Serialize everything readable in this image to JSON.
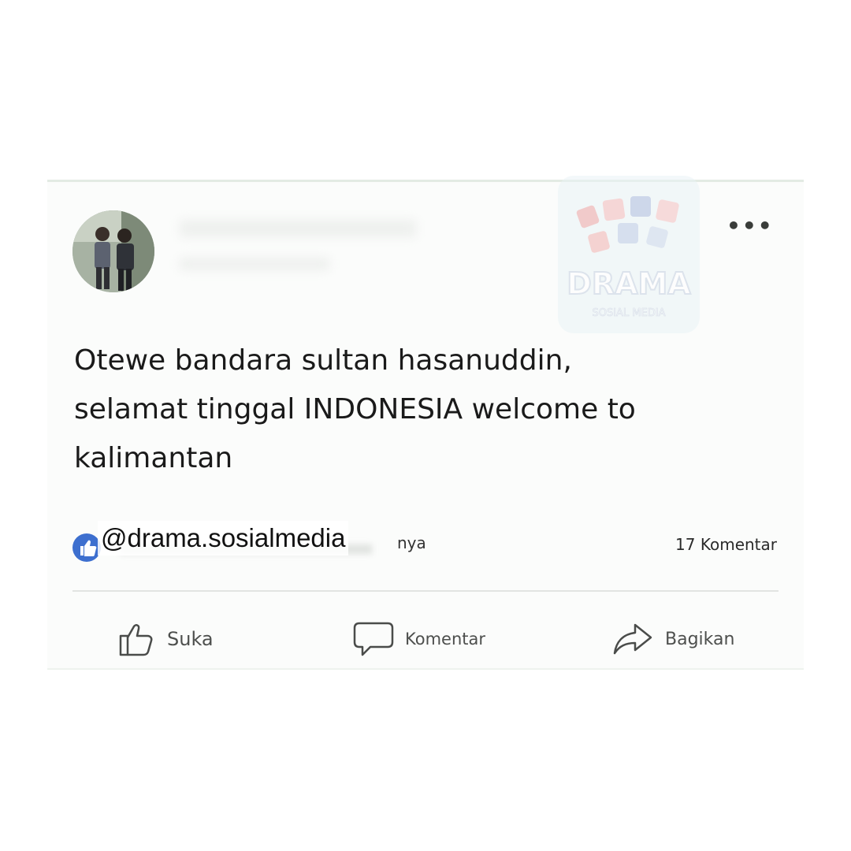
{
  "post": {
    "more_label": "•••",
    "text_lines": [
      "Otewe bandara sultan hasanuddin,",
      "selamat tinggal INDONESIA welcome to",
      "kalimantan"
    ],
    "reactions_tail": "nya",
    "comment_count": "17 Komentar"
  },
  "watermark": {
    "handle": "@drama.sosialmedia",
    "logo_text": "DRAMA",
    "logo_subtext": "SOSIAL MEDIA"
  },
  "actions": {
    "like_label": "Suka",
    "comment_label": "Komentar",
    "share_label": "Bagikan"
  },
  "colors": {
    "like_badge": "#3d6fcf",
    "text": "#1a1a1a",
    "action_text": "#4d4f4d"
  },
  "icons": {
    "like": "thumbs-up-icon",
    "comment": "speech-bubble-icon",
    "share": "share-arrow-icon",
    "more": "more-dots-icon"
  }
}
